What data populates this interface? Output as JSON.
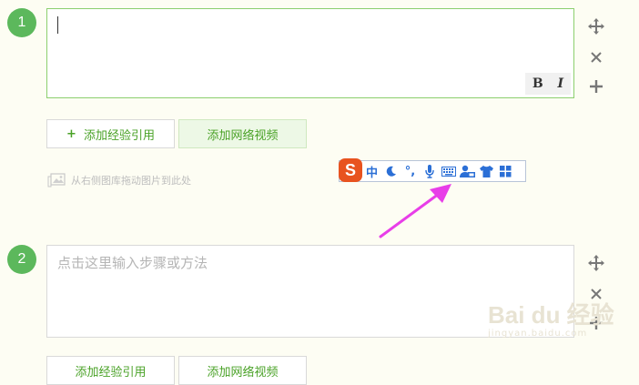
{
  "steps": [
    {
      "number": "1",
      "placeholder": ""
    },
    {
      "number": "2",
      "placeholder": "点击这里输入步骤或方法"
    }
  ],
  "toolbar": {
    "bold": "B",
    "italic": "I"
  },
  "actions": {
    "add_reference_icon": "+",
    "add_reference": "添加经验引用",
    "add_video": "添加网络视频",
    "add_reference_2": "添加经验引用",
    "add_video_2": "添加网络视频"
  },
  "image_hint": "从右侧图库拖动图片到此处",
  "ime": {
    "logo": "S",
    "mode": "中",
    "punct": "°,"
  },
  "watermark": {
    "main": "Bai du 经验",
    "sub": "jingyan.baidu.com"
  },
  "colors": {
    "accent": "#5cb85c",
    "link": "#4aa227",
    "arrow": "#e83ee8",
    "ime_logo": "#e8531f",
    "ime_icon": "#2b6fd6"
  }
}
